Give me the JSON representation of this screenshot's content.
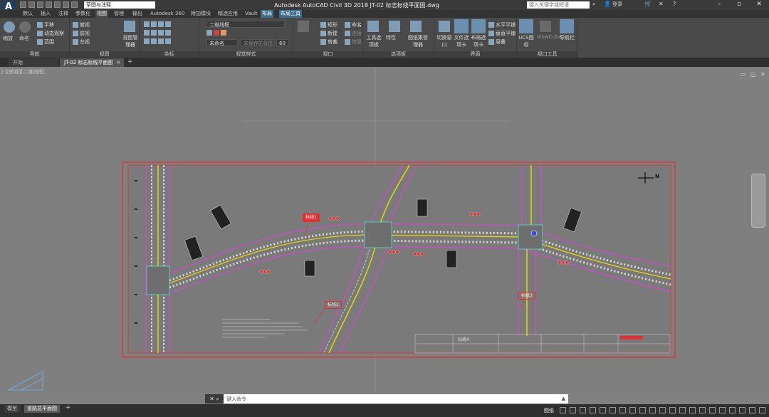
{
  "titlebar": {
    "app_icon": "A",
    "workspace": "草图与注释",
    "title": "Autodesk AutoCAD Civil 3D 2018    JT-02 标志标线平面图.dwg",
    "search_placeholder": "键入关键字或短语",
    "login": "登录"
  },
  "ribbon_tabs": [
    "默认",
    "插入",
    "注释",
    "参数化",
    "视图",
    "管理",
    "输出",
    "Autodesk 360",
    "附加模块",
    "精选应用",
    "Vault",
    "布局",
    "布局工具"
  ],
  "ribbon": {
    "nav": {
      "label": "导航",
      "b1": "动态观察",
      "b2": "平移",
      "b3": "范围",
      "big1": "缩放",
      "big2": "命名"
    },
    "views": {
      "label": "视图",
      "b1": "俯视",
      "b2": "前视",
      "b3": "左视",
      "big": "视图管理器"
    },
    "coords": {
      "label": "坐标"
    },
    "visual": {
      "label": "视觉样式",
      "style": "二维线框",
      "value": "60",
      "layer": "未命名",
      "blank": "未保存的视图"
    },
    "viewport": {
      "label": "视口",
      "b1": "矩形",
      "b2": "新建",
      "b3": "剪裁",
      "b4": "命名",
      "b5": "连接",
      "b6": "恢复"
    },
    "palettes": {
      "label": "选项板",
      "b1": "工具选项板",
      "b2": "特性",
      "b3": "图纸集管理器"
    },
    "interface": {
      "label": "界面",
      "b1": "切换窗口",
      "b2": "文件选项卡",
      "b3": "布局选项卡",
      "b4": "水平平铺",
      "b5": "垂直平铺",
      "b6": "层叠"
    },
    "vptools": {
      "label": "视口工具",
      "b1": "UCS图标",
      "b2": "ViewCube",
      "b3": "导航栏"
    }
  },
  "doc_tabs": [
    "开始",
    "JT-02 标志标线平面图"
  ],
  "canvas_ctl": "[-][俯视][二维线框]",
  "drawing": {
    "label_a": "标线1",
    "label_b": "标线2",
    "label_c": "标线3",
    "label_d": "标线4",
    "north": "N"
  },
  "command": {
    "prompt": "键入命令"
  },
  "layout_tabs": [
    "模型",
    "道路总平面图"
  ],
  "status": {
    "paper": "图纸"
  },
  "colors": {
    "accent": "#3d6d8a",
    "road_edge": "#e040e0",
    "yellow": "#e6d800",
    "red": "#e03030"
  }
}
